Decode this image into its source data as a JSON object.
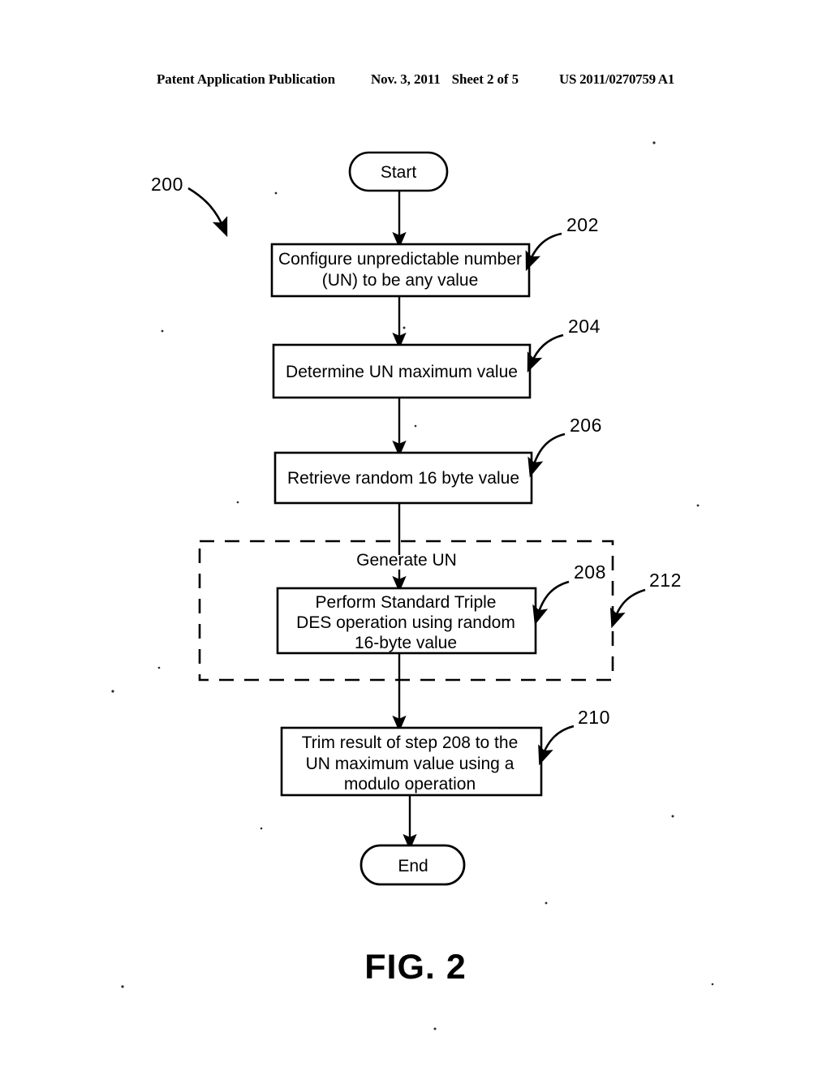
{
  "header": {
    "publication": "Patent Application Publication",
    "date": "Nov. 3, 2011",
    "sheet": "Sheet 2 of 5",
    "patent_number": "US 2011/0270759 A1"
  },
  "figure": {
    "caption": "FIG. 2",
    "diagram_ref": "200",
    "group_label": "Generate UN",
    "group_ref": "212",
    "nodes": {
      "start": {
        "label": "Start"
      },
      "step202": {
        "ref": "202",
        "line1": "Configure unpredictable number",
        "line2": "(UN) to be any value"
      },
      "step204": {
        "ref": "204",
        "line1": "Determine UN maximum value"
      },
      "step206": {
        "ref": "206",
        "line1": "Retrieve random 16 byte value"
      },
      "step208": {
        "ref": "208",
        "line1": "Perform Standard Triple",
        "line2": "DES operation using random",
        "line3": "16-byte value"
      },
      "step210": {
        "ref": "210",
        "line1": "Trim result of step 208 to the",
        "line2": "UN maximum value using a",
        "line3": "modulo operation"
      },
      "end": {
        "label": "End"
      }
    }
  },
  "colors": {
    "ink": "#000000",
    "paper": "#ffffff"
  }
}
